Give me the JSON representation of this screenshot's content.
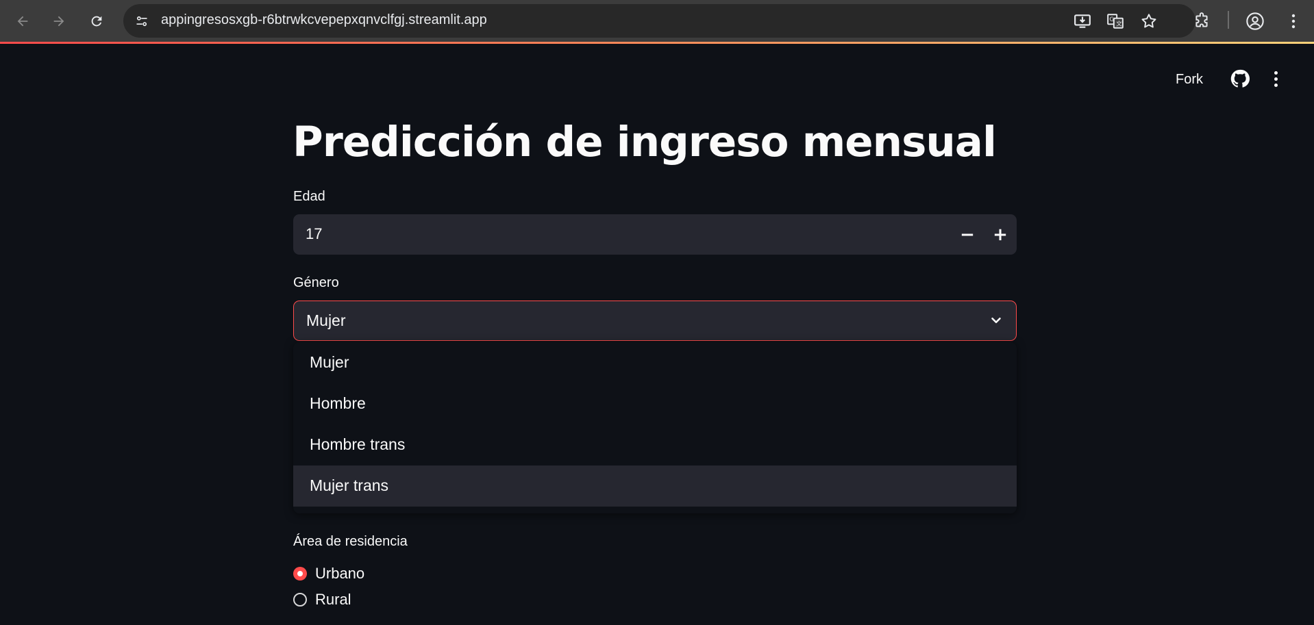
{
  "browser": {
    "url": "appingresosxgb-r6btrwkcvepepxqnvclfgj.streamlit.app",
    "icons": [
      "back-icon",
      "forward-icon",
      "reload-icon",
      "site-info-icon",
      "install-app-icon",
      "translate-icon",
      "bookmark-star-icon",
      "extensions-icon",
      "profile-icon",
      "more-vert-icon"
    ]
  },
  "header": {
    "fork_label": "Fork",
    "icons": [
      "github-icon",
      "main-menu-icon"
    ]
  },
  "main": {
    "title": "Predicción de ingreso mensual",
    "age": {
      "label": "Edad",
      "value": "17",
      "minus": "−",
      "plus": "+"
    },
    "gender": {
      "label": "Género",
      "selected": "Mujer",
      "options": [
        "Mujer",
        "Hombre",
        "Hombre trans",
        "Mujer trans"
      ],
      "highlighted_option": "Mujer trans"
    },
    "area": {
      "label": "Área de residencia",
      "options": [
        "Urbano",
        "Rural"
      ],
      "selected": "Urbano"
    }
  },
  "colors": {
    "accent": "#ff4b4b",
    "background": "#0e1117",
    "widget_bg": "#262730",
    "text": "#fafafa"
  }
}
